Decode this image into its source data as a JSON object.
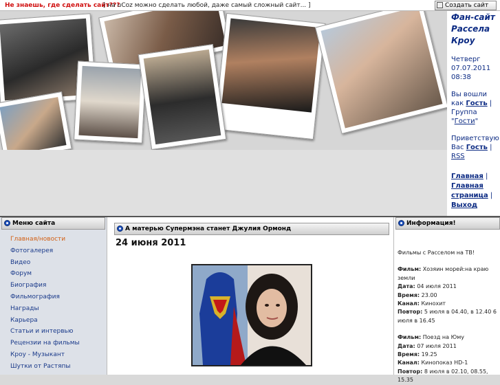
{
  "topbar": {
    "promo": "Не знаешь, где сделать сайт???",
    "tagline": "[ на uCoz можно сделать любой, даже самый сложный сайт... ]",
    "create_button": "Создать сайт"
  },
  "site": {
    "title": "Фан-сайт Рассела Кроу",
    "date": "Четверг 07.07.2011 08:38",
    "greeting_prefix": "Вы вошли как",
    "greeting_user": "Гость",
    "group_label": "Группа \"",
    "group_value": "Гости",
    "welcome": "Приветствую Вас",
    "welcome_user": "Гость",
    "rss": "RSS",
    "nav": [
      "Главная",
      "Главная страница",
      "Выход"
    ]
  },
  "menu": {
    "title": "Меню сайта",
    "items": [
      "Главная/новости",
      "Фотогалерея",
      "Видео",
      "Форум",
      "Биография",
      "Фильмография",
      "Награды",
      "Карьера",
      "Статьи и интервью",
      "Рецензии на фильмы",
      "Кроу - Музыкант",
      "Шутки от Растяпы"
    ]
  },
  "news": {
    "title": "А матерью Супермэна станет Джулия Ормонд",
    "date": "24 июня 2011"
  },
  "info": {
    "title": "Информация!",
    "heading": "Фильмы с Расселом на ТВ!",
    "labels": {
      "film": "Фильм:",
      "date": "Дата:",
      "time": "Время:",
      "channel": "Канал:",
      "repeat": "Повтор:"
    },
    "entries": [
      {
        "film": "Хозяин морей:на краю земли",
        "date": "04 июля 2011",
        "time": "23.00",
        "channel": "Кинохит",
        "repeat": "5 июля в 04.40, в 12.40 6 июля в 16.45"
      },
      {
        "film": "Поезд на Юму",
        "date": "07 июля 2011",
        "time": "19.25",
        "channel": "Кинопоказ HD-1",
        "repeat": "8 июля в 02.10, 08.55, 15.35"
      }
    ]
  },
  "colors": {
    "link": "#0b2a83",
    "active_menu": "#d26015",
    "promo": "#d01010",
    "bullet": "#1d4fbb"
  }
}
